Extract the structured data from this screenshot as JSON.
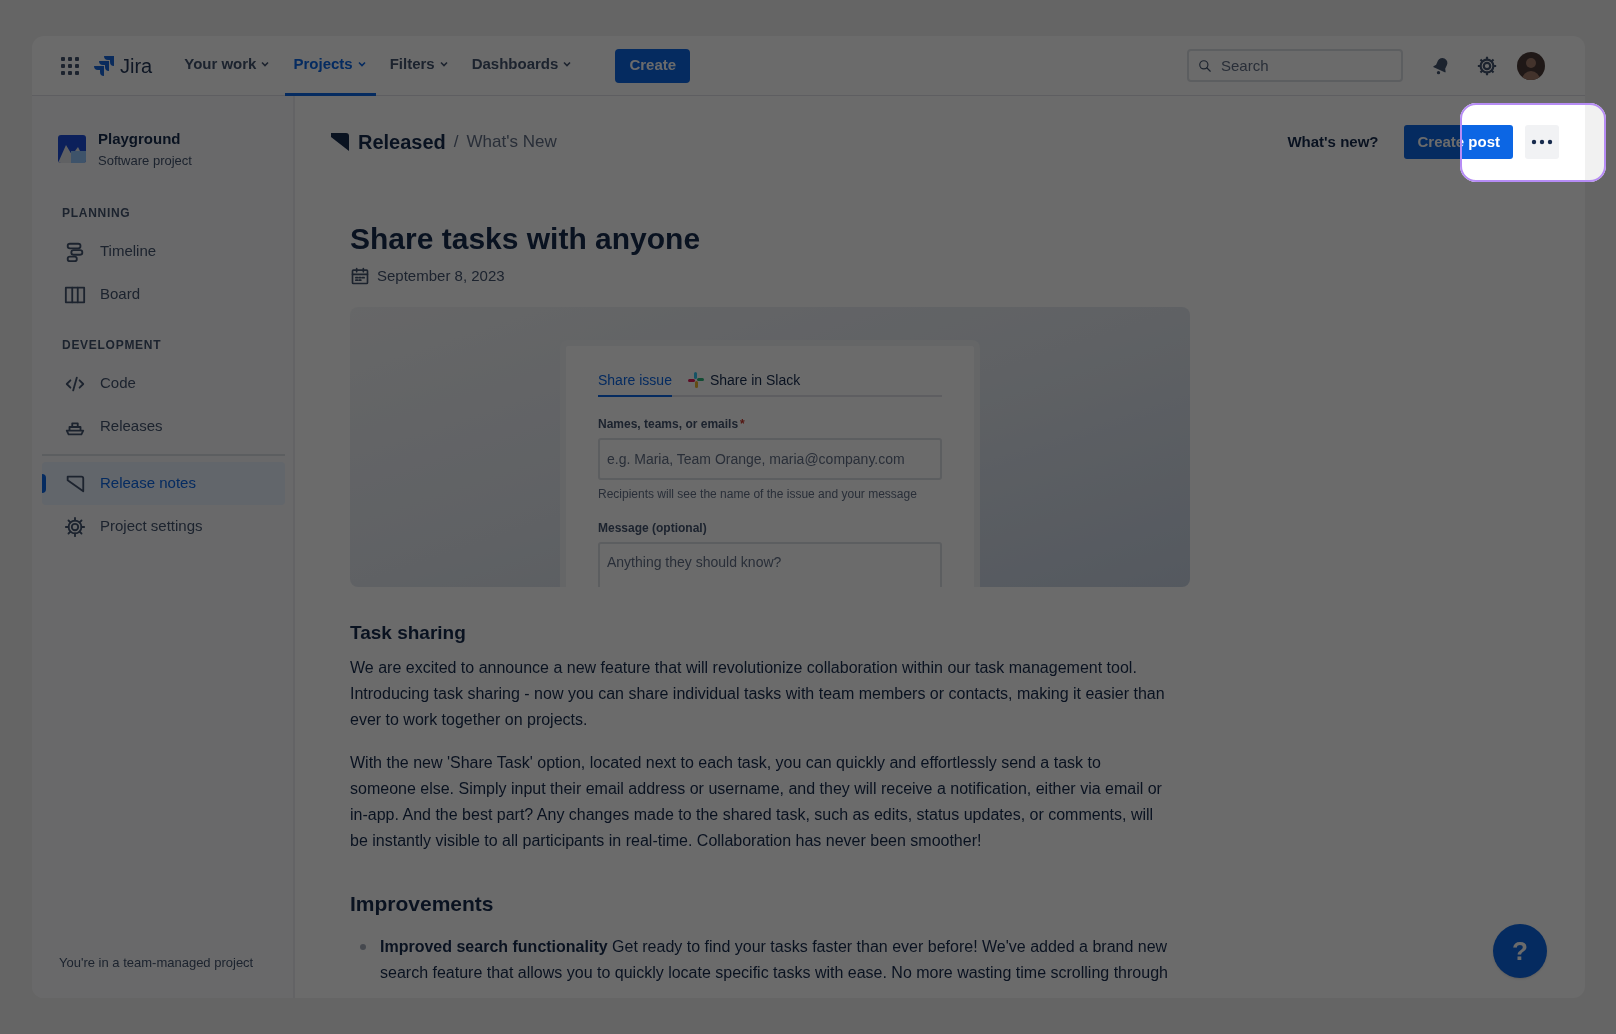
{
  "top_nav": {
    "logo": "Jira",
    "menus": [
      {
        "label": "Your work",
        "selected": false
      },
      {
        "label": "Projects",
        "selected": true
      },
      {
        "label": "Filters",
        "selected": false
      },
      {
        "label": "Dashboards",
        "selected": false
      }
    ],
    "create_button": "Create",
    "search": {
      "placeholder": "Search"
    }
  },
  "sidebar": {
    "project": {
      "name": "Playground",
      "type": "Software project"
    },
    "sections": [
      {
        "heading": "PLANNING",
        "items": [
          {
            "label": "Timeline",
            "kind": "timeline",
            "selected": false
          },
          {
            "label": "Board",
            "kind": "board",
            "selected": false
          }
        ]
      },
      {
        "heading": "DEVELOPMENT",
        "items": [
          {
            "label": "Code",
            "kind": "code",
            "selected": false
          },
          {
            "label": "Releases",
            "kind": "releases",
            "selected": false
          }
        ]
      }
    ],
    "bottom_items": [
      {
        "label": "Release notes",
        "kind": "notes",
        "selected": true
      },
      {
        "label": "Project settings",
        "kind": "settings",
        "selected": false
      }
    ],
    "footer": "You're in a team-managed project"
  },
  "header": {
    "app_name": "Released",
    "separator": "/",
    "page": "What's New",
    "whats_new_link": "What's new?",
    "create_post_button": "Create post"
  },
  "post": {
    "title": "Share tasks with anyone",
    "date": "September 8, 2023",
    "screenshot": {
      "tabs": [
        {
          "label": "Share issue",
          "selected": true
        },
        {
          "label": "Share in Slack",
          "selected": false
        }
      ],
      "fields": [
        {
          "label": "Names, teams, or emails",
          "required_mark": "*",
          "placeholder": "e.g. Maria, Team Orange, maria@company.com",
          "hint": "Recipients will see the name of the issue and your message"
        },
        {
          "label": "Message (optional)",
          "placeholder": "Anything they should know?"
        }
      ]
    },
    "sections": [
      {
        "heading": "Task sharing",
        "kind": "subheading",
        "paragraphs": [
          "We are excited to announce a new feature that will revolutionize collaboration within our task management tool. Introducing task sharing - now you can share individual tasks with team members or contacts, making it easier than ever to work together on projects.",
          "With the new 'Share Task' option, located next to each task, you can quickly and effortlessly send a task to someone else. Simply input their email address or username, and they will receive a notification, either via email or in-app. And the best part? Any changes made to the shared task, such as edits, status updates, or comments, will be instantly visible to all participants in real-time. Collaboration has never been smoother!"
        ]
      },
      {
        "heading": "Improvements",
        "kind": "heading",
        "bullets": [
          "**Improved search functionality** Get ready to find your tasks faster than ever before! We've added a brand new search feature that allows you to quickly locate specific tasks with ease. No more wasting time scrolling through"
        ]
      }
    ]
  },
  "help_button": "?"
}
